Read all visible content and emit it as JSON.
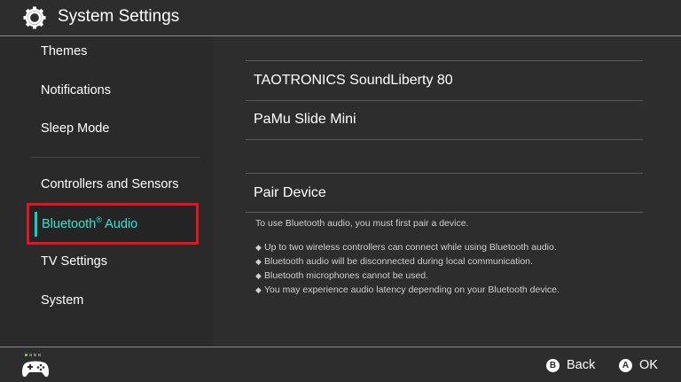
{
  "header": {
    "title": "System Settings",
    "icon": "gear-icon"
  },
  "sidebar": {
    "items": [
      {
        "label": "Themes"
      },
      {
        "label": "Notifications"
      },
      {
        "label": "Sleep Mode"
      },
      {
        "label": "Controllers and Sensors"
      },
      {
        "label": "Bluetooth",
        "suffix": "®",
        "label_rest": " Audio",
        "selected": true
      },
      {
        "label": "TV Settings"
      },
      {
        "label": "System"
      }
    ]
  },
  "content": {
    "devices": [
      {
        "label": "TAOTRONICS SoundLiberty 80"
      },
      {
        "label": "PaMu Slide Mini"
      }
    ],
    "pair_device_label": "Pair Device",
    "info_intro": "To use Bluetooth audio, you must first pair a device.",
    "bullet_symbol": "◆",
    "bullets": [
      "Up to two wireless controllers can connect while using Bluetooth audio.",
      "Bluetooth audio will be disconnected during local communication.",
      "Bluetooth microphones cannot be used.",
      "You may experience audio latency depending on your Bluetooth device."
    ]
  },
  "footer": {
    "controller_icon": "controller-icon",
    "back": {
      "button": "B",
      "label": "Back"
    },
    "ok": {
      "button": "A",
      "label": "OK"
    }
  },
  "colors": {
    "background": "#2d2d2d",
    "selection_border": "#e8141c",
    "selection_text": "#35e3d3",
    "accent_bar": "#00d4c8"
  }
}
